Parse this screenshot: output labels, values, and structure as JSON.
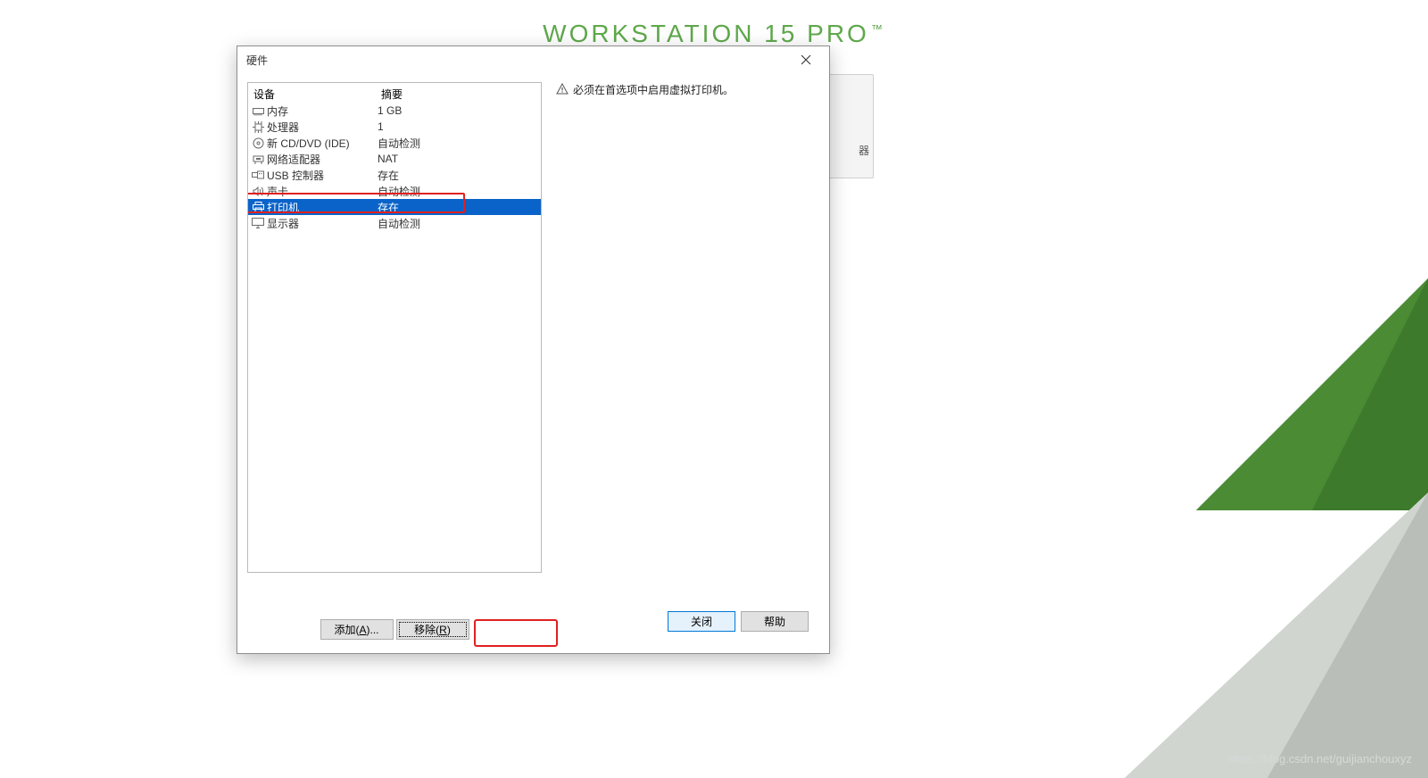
{
  "background": {
    "title_main": "WORKSTATION 15 ",
    "title_accent": "PRO",
    "title_tm": "™",
    "panel_peek": "器"
  },
  "dialog": {
    "title": "硬件",
    "list_header_device": "设备",
    "list_header_summary": "摘要",
    "devices": [
      {
        "icon": "memory",
        "name": "内存",
        "summary": "1 GB",
        "selected": false
      },
      {
        "icon": "cpu",
        "name": "处理器",
        "summary": "1",
        "selected": false
      },
      {
        "icon": "disc",
        "name": "新 CD/DVD (IDE)",
        "summary": "自动检测",
        "selected": false
      },
      {
        "icon": "network",
        "name": "网络适配器",
        "summary": "NAT",
        "selected": false
      },
      {
        "icon": "usb",
        "name": "USB 控制器",
        "summary": "存在",
        "selected": false
      },
      {
        "icon": "sound",
        "name": "声卡",
        "summary": "自动检测",
        "selected": false
      },
      {
        "icon": "printer",
        "name": "打印机",
        "summary": "存在",
        "selected": true
      },
      {
        "icon": "display",
        "name": "显示器",
        "summary": "自动检测",
        "selected": false
      }
    ],
    "add_btn_pre": "添加(",
    "add_btn_key": "A",
    "add_btn_post": ")...",
    "remove_btn_pre": "移除(",
    "remove_btn_key": "R",
    "remove_btn_post": ")",
    "detail_message": "必须在首选项中启用虚拟打印机。",
    "close_btn": "关闭",
    "help_btn": "帮助"
  },
  "watermark": "https://blog.csdn.net/guijianchouxyz"
}
